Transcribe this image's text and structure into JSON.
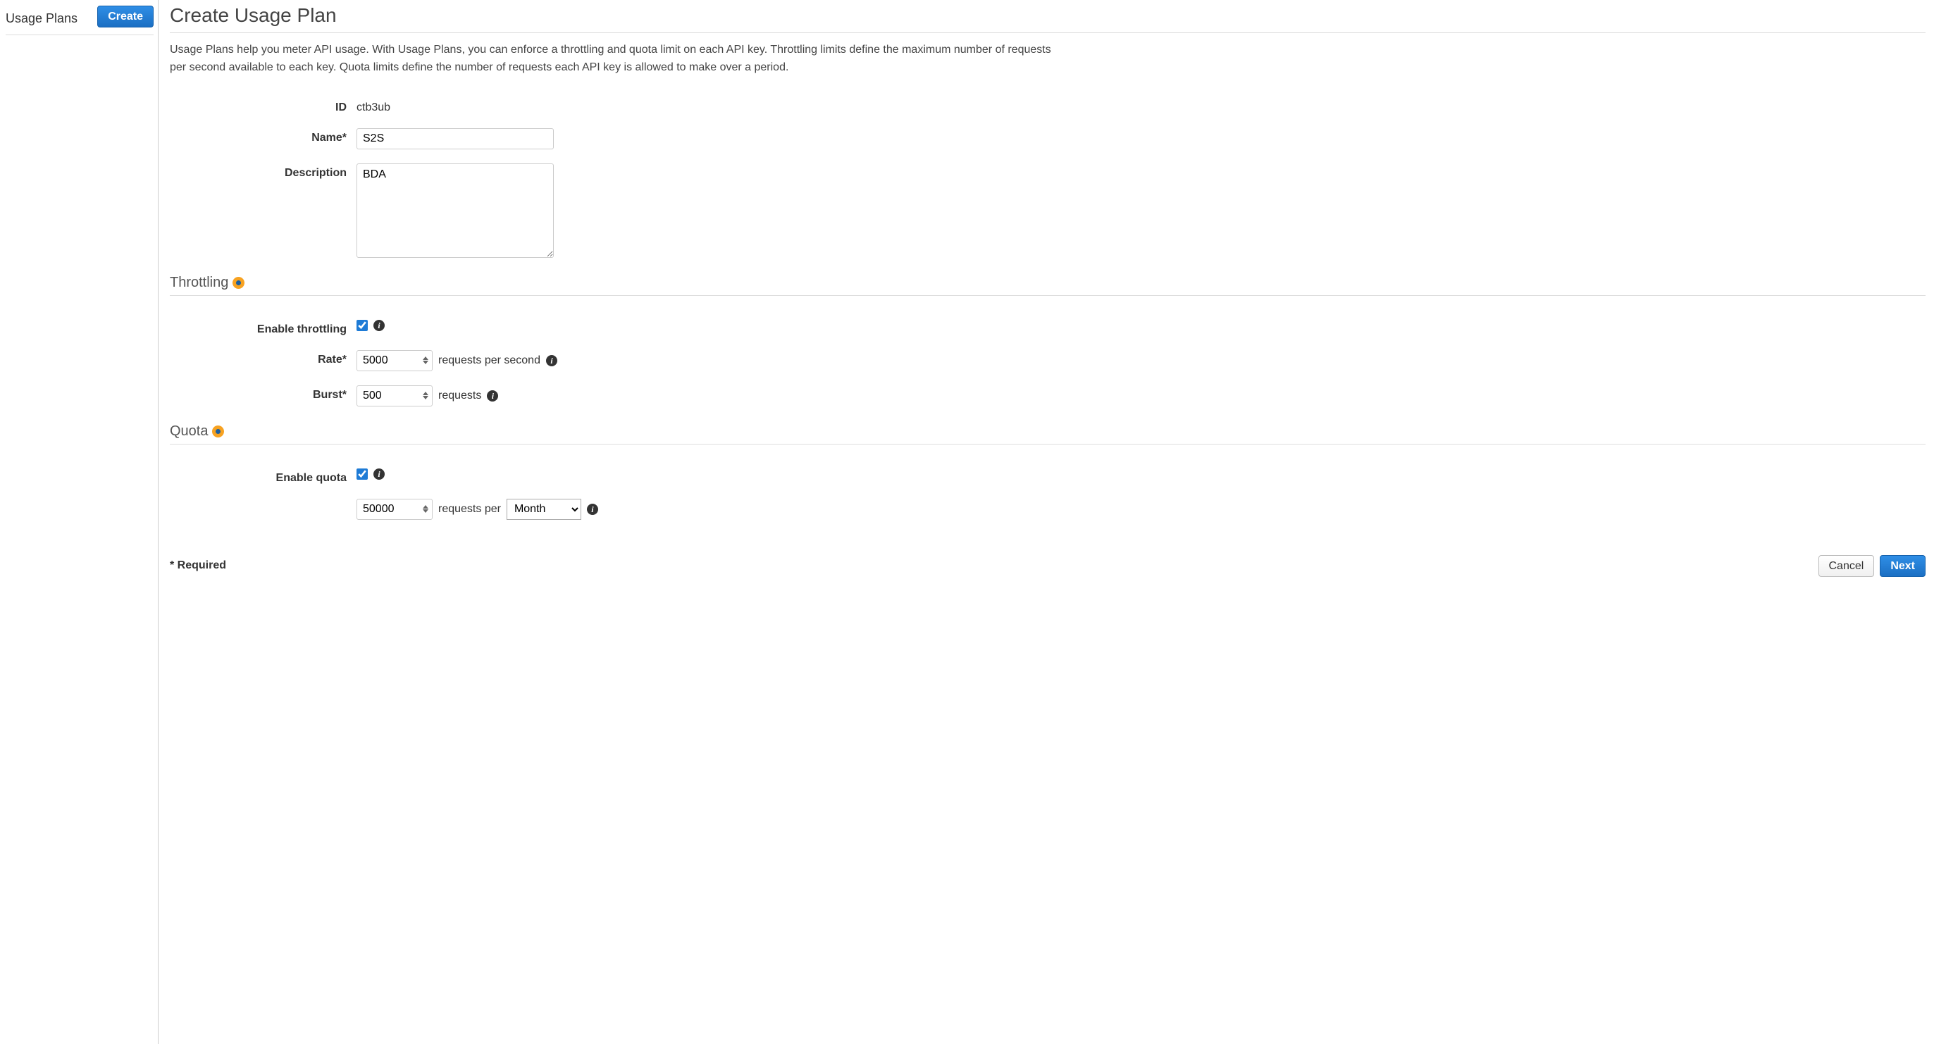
{
  "sidebar": {
    "title": "Usage Plans",
    "create_label": "Create"
  },
  "page": {
    "title": "Create Usage Plan",
    "description": "Usage Plans help you meter API usage. With Usage Plans, you can enforce a throttling and quota limit on each API key. Throttling limits define the maximum number of requests per second available to each key. Quota limits define the number of requests each API key is allowed to make over a period."
  },
  "form": {
    "id_label": "ID",
    "id_value": "ctb3ub",
    "name_label": "Name*",
    "name_value": "S2S",
    "description_label": "Description",
    "description_value": "BDA"
  },
  "throttling": {
    "heading": "Throttling",
    "enable_label": "Enable throttling",
    "enable_checked": true,
    "rate_label": "Rate*",
    "rate_value": "5000",
    "rate_unit": "requests per second",
    "burst_label": "Burst*",
    "burst_value": "500",
    "burst_unit": "requests"
  },
  "quota": {
    "heading": "Quota",
    "enable_label": "Enable quota",
    "enable_checked": true,
    "value": "50000",
    "per_text": "requests per",
    "period": "Month"
  },
  "footer": {
    "required": "* Required",
    "cancel": "Cancel",
    "next": "Next"
  }
}
